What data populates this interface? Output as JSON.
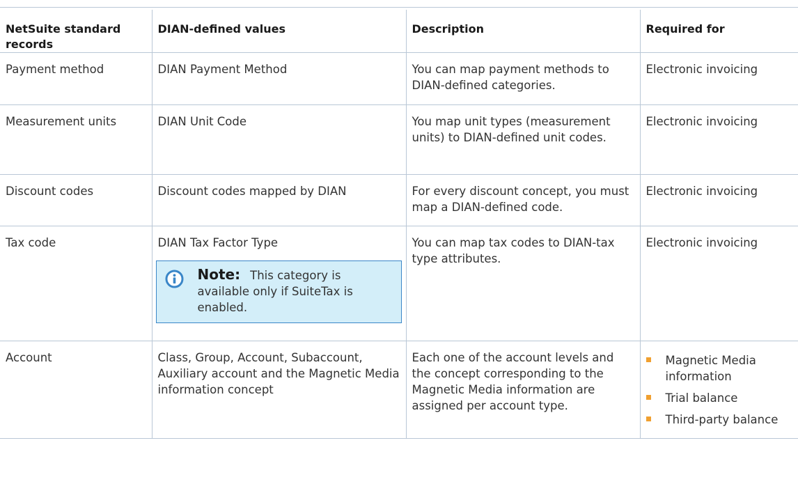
{
  "table": {
    "headers": [
      "NetSuite standard records",
      "DIAN-defined values",
      "Description",
      "Required for"
    ],
    "rows": [
      {
        "record": "Payment method",
        "values": "DIAN Payment Method",
        "description": "You can map payment methods to DIAN-defined categories.",
        "required": "Electronic invoicing"
      },
      {
        "record": "Measurement units",
        "values": "DIAN Unit Code",
        "description": "You map unit types (measurement units) to DIAN-defined unit codes.",
        "required": "Electronic invoicing"
      },
      {
        "record": "Discount codes",
        "values": "Discount codes mapped by DIAN",
        "description": "For every discount concept, you must map a DIAN-defined code.",
        "required": "Electronic invoicing"
      },
      {
        "record": "Tax code",
        "values": "DIAN Tax Factor Type",
        "note": {
          "icon": "info-icon",
          "label": "Note:",
          "text": "This category is available only if SuiteTax is enabled."
        },
        "description": "You can map tax codes to DIAN-tax type attributes.",
        "required": "Electronic invoicing"
      },
      {
        "record": "Account",
        "values": "Class, Group, Account, Subaccount, Auxiliary account and the Magnetic Media information concept",
        "description": "Each one of the account levels and the concept corresponding to the Magnetic Media information are assigned per account type.",
        "required_list": [
          "Magnetic Media information",
          "Trial balance",
          "Third-party balance"
        ]
      }
    ]
  },
  "colors": {
    "note_bg": "#d3eef9",
    "note_border": "#3a86c8",
    "bullet": "#f0a030",
    "rule": "#b9c7d6"
  }
}
